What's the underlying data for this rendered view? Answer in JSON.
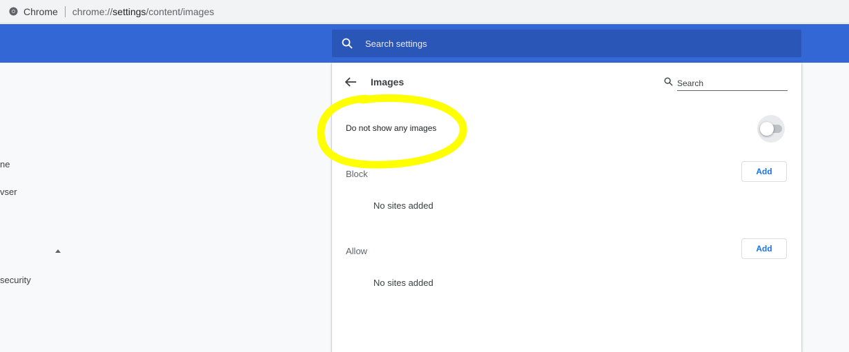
{
  "browser": {
    "site_label": "Chrome",
    "url_prefix": "chrome://",
    "url_host": "settings",
    "url_path": "/content/images"
  },
  "header": {
    "search_placeholder": "Search settings"
  },
  "sidebar": {
    "items": [
      {
        "label": "ne"
      },
      {
        "label": "vser"
      },
      {
        "label": "security"
      }
    ]
  },
  "page": {
    "title": "Images",
    "search_placeholder": "Search",
    "toggle_label": "Do not show any images",
    "toggle_on": false,
    "block": {
      "label": "Block",
      "add_label": "Add",
      "empty_text": "No sites added"
    },
    "allow": {
      "label": "Allow",
      "add_label": "Add",
      "empty_text": "No sites added"
    }
  },
  "colors": {
    "header_blue": "#3367d6",
    "highlight": "#ffff00",
    "link_blue": "#1a73e8"
  }
}
